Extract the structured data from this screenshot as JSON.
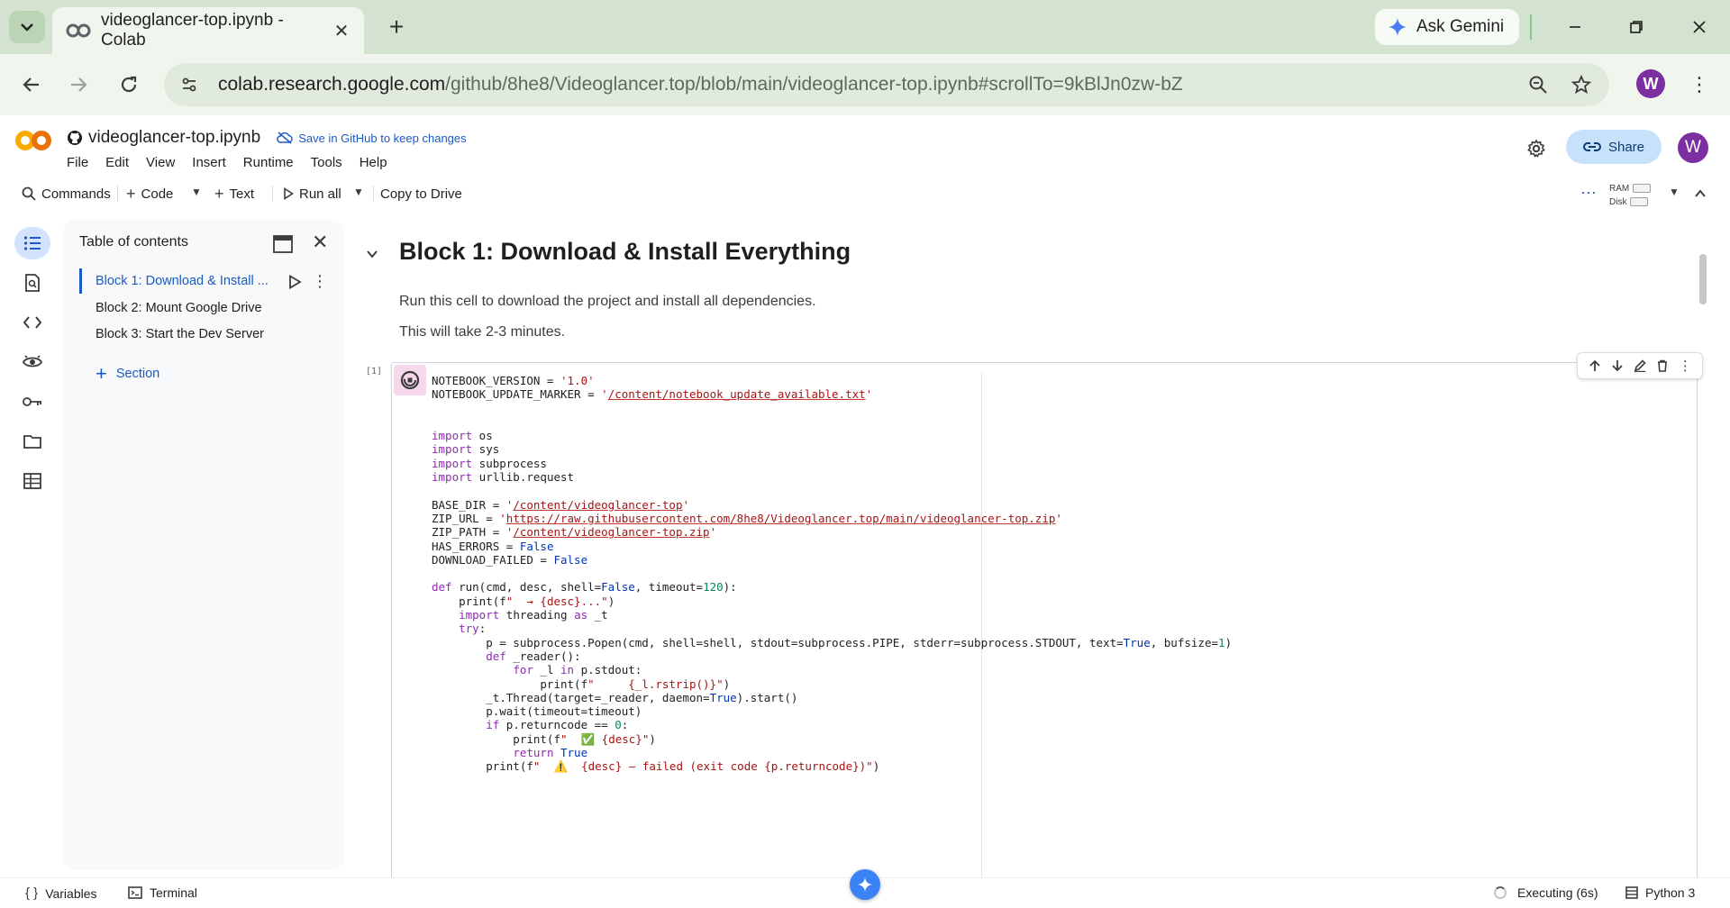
{
  "browser": {
    "tab_title": "videoglancer-top.ipynb - Colab",
    "ask_gemini": "Ask Gemini",
    "url_host": "colab.research.google.com",
    "url_path": "/github/8he8/Videoglancer.top/blob/main/videoglancer-top.ipynb#scrollTo=9kBlJn0zw-bZ",
    "profile_initial": "W",
    "accent": "#d3e3cf"
  },
  "header": {
    "notebook_title": "videoglancer-top.ipynb",
    "save_github": "Save in GitHub to keep changes",
    "menu": [
      "File",
      "Edit",
      "View",
      "Insert",
      "Runtime",
      "Tools",
      "Help"
    ],
    "share": "Share",
    "avatar_initial": "W"
  },
  "toolbar": {
    "commands": "Commands",
    "code": "Code",
    "text": "Text",
    "run_all": "Run all",
    "copy_to_drive": "Copy to Drive",
    "ram": "RAM",
    "disk": "Disk"
  },
  "toc": {
    "title": "Table of contents",
    "items": [
      "Block 1: Download & Install ...",
      "Block 2: Mount Google Drive",
      "Block 3: Start the Dev Server"
    ],
    "add_section": "Section"
  },
  "notebook": {
    "heading": "Block 1: Download & Install Everything",
    "paragraph1": "Run this cell to download the project and install all dependencies.",
    "paragraph2": "This will take 2-3 minutes.",
    "cell_label": "[1]",
    "code_lines": [
      "NOTEBOOK_VERSION = '1.0'",
      "NOTEBOOK_UPDATE_MARKER = '/content/notebook_update_available.txt'",
      "",
      "",
      "import os",
      "import sys",
      "import subprocess",
      "import urllib.request",
      "",
      "BASE_DIR = '/content/videoglancer-top'",
      "ZIP_URL = 'https://raw.githubusercontent.com/8he8/Videoglancer.top/main/videoglancer-top.zip'",
      "ZIP_PATH = '/content/videoglancer-top.zip'",
      "HAS_ERRORS = False",
      "DOWNLOAD_FAILED = False",
      "",
      "def run(cmd, desc, shell=False, timeout=120):",
      "    print(f\"  → {desc}...\")",
      "    import threading as _t",
      "    try:",
      "        p = subprocess.Popen(cmd, shell=shell, stdout=subprocess.PIPE, stderr=subprocess.STDOUT, text=True, bufsize=1)",
      "        def _reader():",
      "            for _l in p.stdout:",
      "                print(f\"     {_l.rstrip()}\")",
      "        _t.Thread(target=_reader, daemon=True).start()",
      "        p.wait(timeout=timeout)",
      "        if p.returncode == 0:",
      "            print(f\"  ✅ {desc}\")",
      "            return True",
      "        print(f\"  ⚠️  {desc} — failed (exit code {p.returncode})\")"
    ]
  },
  "status": {
    "variables": "Variables",
    "terminal": "Terminal",
    "executing": "Executing (6s)",
    "kernel": "Python 3"
  }
}
